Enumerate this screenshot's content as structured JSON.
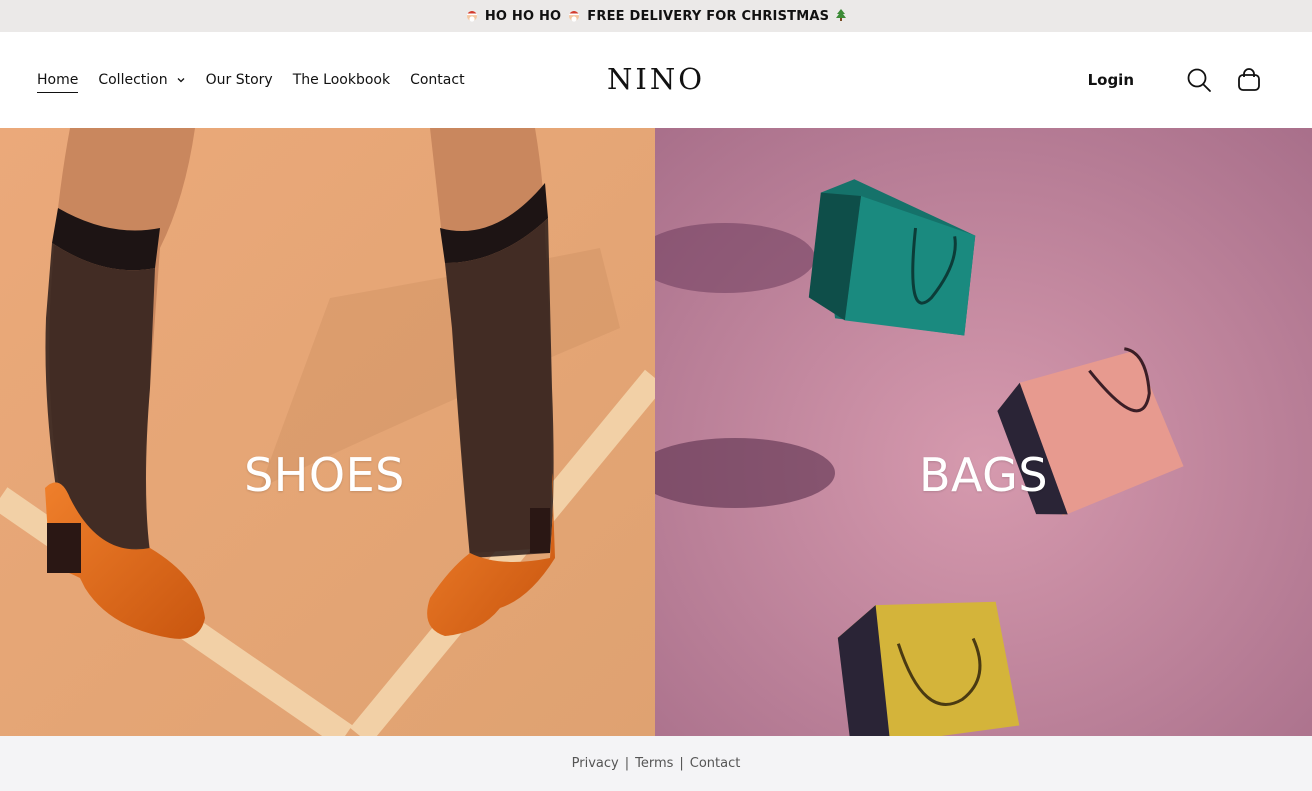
{
  "announcement": {
    "text": "HO HO HO",
    "text2": "FREE DELIVERY FOR CHRISTMAS",
    "icons": [
      "santa-icon",
      "santa-icon",
      "christmas-tree-icon"
    ]
  },
  "header": {
    "brand": "NINO",
    "nav": [
      {
        "label": "Home",
        "active": true
      },
      {
        "label": "Collection",
        "has_dropdown": true
      },
      {
        "label": "Our Story"
      },
      {
        "label": "The Lookbook"
      },
      {
        "label": "Contact"
      }
    ],
    "login_label": "Login",
    "icons": [
      "search-icon",
      "shopping-bag-icon",
      "chevron-down-icon"
    ]
  },
  "hero": {
    "shoes_label": "SHOES",
    "bags_label": "BAGS",
    "colors": {
      "shoes_bg": "#e7a878",
      "bags_bg": "#c98ea3"
    }
  },
  "footer": {
    "links": [
      "Privacy",
      "Terms",
      "Contact"
    ]
  }
}
